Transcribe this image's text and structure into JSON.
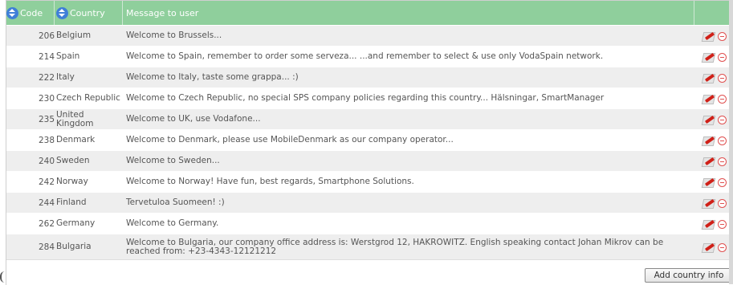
{
  "table": {
    "columns": {
      "code": "Code",
      "country": "Country",
      "message": "Message to user"
    },
    "rows": [
      {
        "code": "206",
        "country": "Belgium",
        "message": "Welcome to Brussels..."
      },
      {
        "code": "214",
        "country": "Spain",
        "message": "Welcome to Spain, remember to order some serveza... ...and remember to select & use only VodaSpain network."
      },
      {
        "code": "222",
        "country": "Italy",
        "message": "Welcome to Italy, taste some grappa... :)"
      },
      {
        "code": "230",
        "country": "Czech Republic",
        "message": "Welcome to Czech Republic, no special SPS company policies regarding this country... Hälsningar, SmartManager"
      },
      {
        "code": "235",
        "country": "United Kingdom",
        "message": "Welcome to UK, use Vodafone..."
      },
      {
        "code": "238",
        "country": "Denmark",
        "message": "Welcome to Denmark, please use MobileDenmark as our company operator..."
      },
      {
        "code": "240",
        "country": "Sweden",
        "message": "Welcome to Sweden..."
      },
      {
        "code": "242",
        "country": "Norway",
        "message": "Welcome to Norway! Have fun, best regards, Smartphone Solutions."
      },
      {
        "code": "244",
        "country": "Finland",
        "message": "Tervetuloa Suomeen! :)"
      },
      {
        "code": "262",
        "country": "Germany",
        "message": "Welcome to Germany."
      },
      {
        "code": "284",
        "country": "Bulgaria",
        "message": "Welcome to Bulgaria, our company office address is: Werstgrod 12, HAKROWITZ. English speaking contact Johan Mikrov can be reached from: +23-4343-12121212"
      }
    ]
  },
  "actions": {
    "add_label": "Add country info"
  },
  "icons": {
    "sort": "sort-updown-icon",
    "edit": "edit-pencil-icon",
    "delete": "delete-minus-icon"
  },
  "colors": {
    "header_bg": "#8fcf9c",
    "row_alt_bg": "#eeeeee",
    "sort_icon": "#3f7fd7",
    "delete_icon": "#e05050"
  }
}
